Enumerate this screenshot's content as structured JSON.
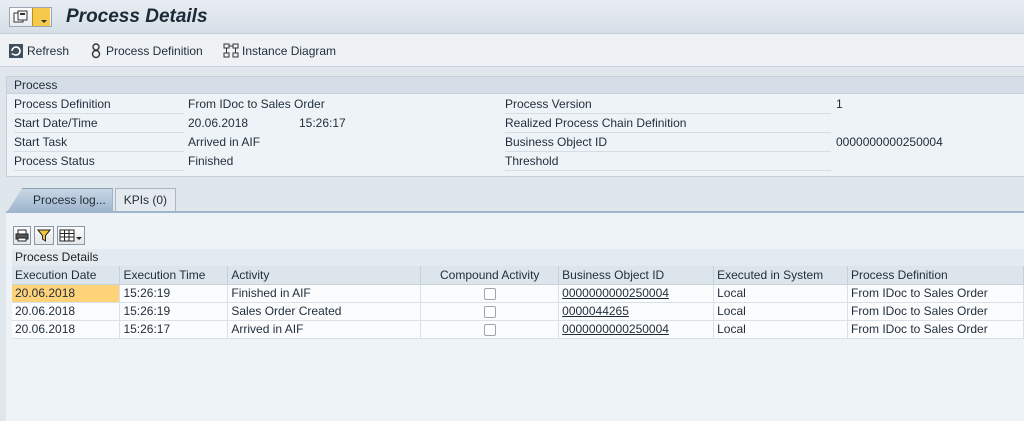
{
  "header": {
    "title": "Process Details"
  },
  "toolbar": {
    "refresh_label": "Refresh",
    "process_definition_label": "Process Definition",
    "instance_diagram_label": "Instance Diagram"
  },
  "process": {
    "section_title": "Process",
    "left": [
      {
        "label": "Process Definition",
        "value": "From IDoc to Sales Order"
      },
      {
        "label": "Start Date/Time",
        "value": "20.06.2018",
        "value2": "15:26:17"
      },
      {
        "label": "Start Task",
        "value": "Arrived in AIF"
      },
      {
        "label": "Process Status",
        "value": "Finished"
      }
    ],
    "right": [
      {
        "label": "Process Version",
        "value": "1"
      },
      {
        "label": "Realized Process Chain Definition",
        "value": ""
      },
      {
        "label": "Business Object ID",
        "value": "0000000000250004"
      },
      {
        "label": "Threshold",
        "value": ""
      }
    ]
  },
  "tabs": [
    {
      "label": "Process log...",
      "active": true
    },
    {
      "label": "KPIs (0)",
      "active": false
    }
  ],
  "grid": {
    "title": "Process Details",
    "columns": [
      "Execution Date",
      "Execution Time",
      "Activity",
      "Compound Activity",
      "Business Object ID",
      "Executed in System",
      "Process Definition"
    ],
    "rows": [
      {
        "date": "20.06.2018",
        "time": "15:26:19",
        "activity": "Finished in AIF",
        "compound": false,
        "bo_id": "0000000000250004",
        "system": "Local",
        "definition": "From IDoc to Sales Order"
      },
      {
        "date": "20.06.2018",
        "time": "15:26:19",
        "activity": "Sales Order Created",
        "compound": false,
        "bo_id": "0000044265",
        "system": "Local",
        "definition": "From IDoc to Sales Order"
      },
      {
        "date": "20.06.2018",
        "time": "15:26:17",
        "activity": "Arrived in AIF",
        "compound": false,
        "bo_id": "0000000000250004",
        "system": "Local",
        "definition": "From IDoc to Sales Order"
      }
    ]
  },
  "colors": {
    "selection": "#ffd37a",
    "accent": "#9fb6cd"
  }
}
